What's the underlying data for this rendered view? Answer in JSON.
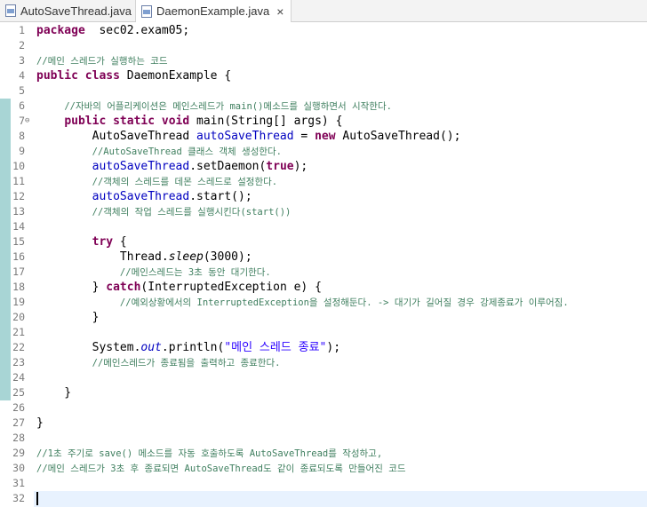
{
  "tabs": [
    {
      "label": "AutoSaveThread.java",
      "active": false
    },
    {
      "label": "DaemonExample.java",
      "active": true
    }
  ],
  "close_glyph": "×",
  "fold_glyph": "⊖",
  "editor": {
    "cursor_line": 32,
    "fold_line": 7,
    "lines": [
      {
        "n": "1",
        "parts": [
          [
            "kw",
            "package"
          ],
          [
            "",
            "  sec02.exam05;"
          ]
        ]
      },
      {
        "n": "2",
        "parts": []
      },
      {
        "n": "3",
        "parts": [
          [
            "cm",
            "//메인 스레드가 실행하는 코드"
          ]
        ]
      },
      {
        "n": "4",
        "parts": [
          [
            "kw",
            "public class"
          ],
          [
            "",
            " DaemonExample {"
          ]
        ]
      },
      {
        "n": "5",
        "parts": []
      },
      {
        "n": "6",
        "parts": [
          [
            "",
            "    "
          ],
          [
            "cm",
            "//자바의 어플리케이션은 메인스레드가 main()메소드를 실행하면서 시작한다."
          ]
        ]
      },
      {
        "n": "7",
        "parts": [
          [
            "",
            "    "
          ],
          [
            "kw",
            "public static void"
          ],
          [
            "",
            " main(String[] args) {"
          ]
        ]
      },
      {
        "n": "8",
        "parts": [
          [
            "",
            "        AutoSaveThread "
          ],
          [
            "fld",
            "autoSaveThread"
          ],
          [
            "",
            " = "
          ],
          [
            "kw",
            "new"
          ],
          [
            "",
            " AutoSaveThread();"
          ]
        ]
      },
      {
        "n": "9",
        "parts": [
          [
            "",
            "        "
          ],
          [
            "cm",
            "//AutoSaveThread 클래스 객체 생성한다."
          ]
        ]
      },
      {
        "n": "10",
        "parts": [
          [
            "",
            "        "
          ],
          [
            "fld",
            "autoSaveThread"
          ],
          [
            "",
            ".setDaemon("
          ],
          [
            "kw",
            "true"
          ],
          [
            "",
            ");"
          ]
        ]
      },
      {
        "n": "11",
        "parts": [
          [
            "",
            "        "
          ],
          [
            "cm",
            "//객체의 스레드를 데몬 스레드로 설정한다."
          ]
        ]
      },
      {
        "n": "12",
        "parts": [
          [
            "",
            "        "
          ],
          [
            "fld",
            "autoSaveThread"
          ],
          [
            "",
            ".start();"
          ]
        ]
      },
      {
        "n": "13",
        "parts": [
          [
            "",
            "        "
          ],
          [
            "cm",
            "//객체의 작업 스레드를 실행시킨다(start())"
          ]
        ]
      },
      {
        "n": "14",
        "parts": []
      },
      {
        "n": "15",
        "parts": [
          [
            "",
            "        "
          ],
          [
            "kw",
            "try"
          ],
          [
            "",
            " {"
          ]
        ]
      },
      {
        "n": "16",
        "parts": [
          [
            "",
            "            Thread."
          ],
          [
            "it",
            "sleep"
          ],
          [
            "",
            "(3000);"
          ]
        ]
      },
      {
        "n": "17",
        "parts": [
          [
            "",
            "            "
          ],
          [
            "cm",
            "//메인스레드는 3초 동안 대기한다."
          ]
        ]
      },
      {
        "n": "18",
        "parts": [
          [
            "",
            "        } "
          ],
          [
            "kw",
            "catch"
          ],
          [
            "",
            "(InterruptedException e) {"
          ]
        ]
      },
      {
        "n": "19",
        "parts": [
          [
            "",
            "            "
          ],
          [
            "cm",
            "//예외상황에서의 InterruptedException을 설정해둔다. -> 대기가 길어질 경우 강제종료가 이루어짐."
          ]
        ]
      },
      {
        "n": "20",
        "parts": [
          [
            "",
            "        }"
          ]
        ]
      },
      {
        "n": "21",
        "parts": []
      },
      {
        "n": "22",
        "parts": [
          [
            "",
            "        System."
          ],
          [
            "fld it",
            "out"
          ],
          [
            "",
            ".println("
          ],
          [
            "str",
            "\"메인 스레드 종료\""
          ],
          [
            "",
            ");"
          ]
        ]
      },
      {
        "n": "23",
        "parts": [
          [
            "",
            "        "
          ],
          [
            "cm",
            "//메인스레드가 종료됨을 출력하고 종료한다."
          ]
        ]
      },
      {
        "n": "24",
        "parts": []
      },
      {
        "n": "25",
        "parts": [
          [
            "",
            "    }"
          ]
        ]
      },
      {
        "n": "26",
        "parts": []
      },
      {
        "n": "27",
        "parts": [
          [
            "",
            "}"
          ]
        ]
      },
      {
        "n": "28",
        "parts": []
      },
      {
        "n": "29",
        "parts": [
          [
            "cm",
            "//1초 주기로 save() 메소드를 자동 호출하도록 AutoSaveThread를 작성하고,"
          ]
        ]
      },
      {
        "n": "30",
        "parts": [
          [
            "cm",
            "//메인 스레드가 3초 후 종료되면 AutoSaveThread도 같이 종료되도록 만들어진 코드"
          ]
        ]
      },
      {
        "n": "31",
        "parts": []
      },
      {
        "n": "32",
        "parts": []
      }
    ]
  }
}
